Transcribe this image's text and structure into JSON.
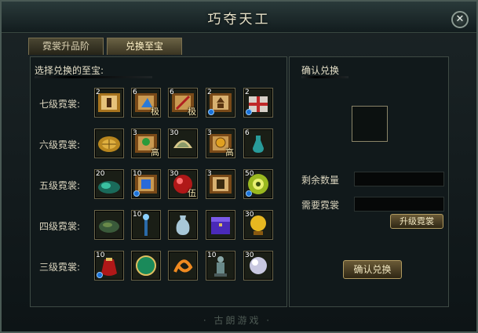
{
  "window": {
    "title": "巧夺天工",
    "close_glyph": "✕"
  },
  "tabs": [
    {
      "label": "霓裳升品阶",
      "active": false
    },
    {
      "label": "兑换至宝",
      "active": true
    }
  ],
  "left": {
    "header": "选择兑换的至宝:",
    "rows": [
      {
        "label": "七级霓裳:",
        "items": [
          {
            "count": "2",
            "badge": "",
            "blue": false,
            "icon": "scroll-figure-icon"
          },
          {
            "count": "6",
            "badge": "极",
            "blue": false,
            "icon": "scroll-blue-icon"
          },
          {
            "count": "6",
            "badge": "极",
            "blue": false,
            "icon": "scroll-sword-icon"
          },
          {
            "count": "2",
            "badge": "",
            "blue": true,
            "icon": "scroll-pagoda-icon"
          },
          {
            "count": "2",
            "badge": "",
            "blue": true,
            "icon": "gift-box-icon"
          }
        ]
      },
      {
        "label": "六级霓裳:",
        "items": [
          {
            "count": "",
            "badge": "",
            "blue": false,
            "icon": "turtle-shell-icon"
          },
          {
            "count": "3",
            "badge": "高",
            "blue": false,
            "icon": "scroll-tree-icon"
          },
          {
            "count": "30",
            "badge": "",
            "blue": false,
            "icon": "jade-shell-icon"
          },
          {
            "count": "3",
            "badge": "高",
            "blue": false,
            "icon": "scroll-coin-icon"
          },
          {
            "count": "6",
            "badge": "",
            "blue": false,
            "icon": "bottle-icon"
          }
        ]
      },
      {
        "label": "五级霓裳:",
        "items": [
          {
            "count": "20",
            "badge": "",
            "blue": false,
            "icon": "green-crystal-icon"
          },
          {
            "count": "10",
            "badge": "",
            "blue": true,
            "icon": "scroll-book-icon"
          },
          {
            "count": "30",
            "badge": "伍",
            "blue": false,
            "icon": "red-orb-icon"
          },
          {
            "count": "3",
            "badge": "",
            "blue": false,
            "icon": "scroll-gate-icon"
          },
          {
            "count": "50",
            "badge": "",
            "blue": true,
            "icon": "jade-disc-icon"
          }
        ]
      },
      {
        "label": "四级霓裳:",
        "items": [
          {
            "count": "",
            "badge": "",
            "blue": false,
            "icon": "mossy-stone-icon"
          },
          {
            "count": "10",
            "badge": "",
            "blue": false,
            "icon": "crystal-staff-icon"
          },
          {
            "count": "",
            "badge": "",
            "blue": false,
            "icon": "vase-icon"
          },
          {
            "count": "",
            "badge": "",
            "blue": false,
            "icon": "purple-chest-icon"
          },
          {
            "count": "30",
            "badge": "",
            "blue": false,
            "icon": "golden-orb-icon"
          }
        ]
      },
      {
        "label": "三级霓裳:",
        "items": [
          {
            "count": "10",
            "badge": "",
            "blue": true,
            "icon": "red-pouch-icon"
          },
          {
            "count": "",
            "badge": "",
            "blue": false,
            "icon": "globe-icon"
          },
          {
            "count": "",
            "badge": "",
            "blue": false,
            "icon": "orange-swirl-icon"
          },
          {
            "count": "10",
            "badge": "",
            "blue": false,
            "icon": "statue-icon"
          },
          {
            "count": "30",
            "badge": "",
            "blue": false,
            "icon": "silver-orb-icon"
          }
        ]
      }
    ]
  },
  "right": {
    "header": "确认兑换",
    "remaining_label": "剩余数量",
    "remaining_value": "",
    "needed_label": "需要霓裳",
    "needed_value": "",
    "upgrade_button": "升级霓裳",
    "confirm_button": "确认兑换"
  },
  "footer": "· 古朗游戏 ·"
}
